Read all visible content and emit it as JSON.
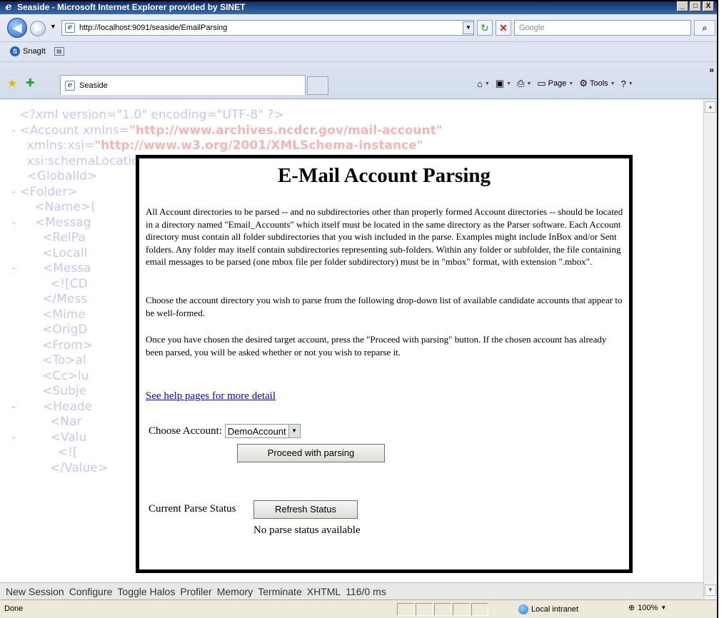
{
  "window": {
    "title": "Seaside - Microsoft Internet Explorer provided by SINET",
    "controls": [
      "_",
      "□",
      "X"
    ]
  },
  "toolbar": {
    "address": "http://localhost:9091/seaside/EmailParsing",
    "search_placeholder": "Google",
    "snagit_label": "SnagIt"
  },
  "tab": {
    "label": "Seaside"
  },
  "commandbar": {
    "page_label": "Page",
    "tools_label": "Tools"
  },
  "background_xml": [
    {
      "prefix": "  ",
      "text": "<?xml version=\"1.0\" encoding=\"UTF-8\" ?>",
      "value": ""
    },
    {
      "prefix": "- ",
      "text": "<Account xmlns=",
      "value": "\"http://www.archives.ncdcr.gov/mail-account\""
    },
    {
      "prefix": "  ",
      "text": "  xmlns:xsi=",
      "value": "\"http://www.w3.org/2001/XMLSchema-instance\""
    },
    {
      "prefix": "  ",
      "text": "  xsi:schemaLocation=\"http://www.archives.ncdcr.gov/mail-account mail-ac",
      "value": ""
    },
    {
      "prefix": "  ",
      "text": "  <GlobalId>                                                   g</Globa",
      "value": ""
    },
    {
      "prefix": "- ",
      "text": "<Folder>",
      "value": ""
    },
    {
      "prefix": "  ",
      "text": "    <Name>(",
      "value": ""
    },
    {
      "prefix": "- ",
      "text": "    <Messag",
      "value": ""
    },
    {
      "prefix": "  ",
      "text": "      <RelPa",
      "value": ""
    },
    {
      "prefix": "  ",
      "text": "      <LocalI",
      "value": ""
    },
    {
      "prefix": "- ",
      "text": "      <Messa",
      "value": ""
    },
    {
      "prefix": "  ",
      "text": "        <![CD",
      "value": ""
    },
    {
      "prefix": "  ",
      "text": "      </Mess",
      "value": ""
    },
    {
      "prefix": "  ",
      "text": "      <Mime",
      "value": ""
    },
    {
      "prefix": "  ",
      "text": "      <OrigD",
      "value": ""
    },
    {
      "prefix": "  ",
      "text": "      <From>",
      "value": ""
    },
    {
      "prefix": "  ",
      "text": "      <To>al",
      "value": ""
    },
    {
      "prefix": "  ",
      "text": "      <Cc>lu",
      "value": ""
    },
    {
      "prefix": "  ",
      "text": "      <Subje",
      "value": ""
    },
    {
      "prefix": "- ",
      "text": "      <Heade",
      "value": ""
    },
    {
      "prefix": "  ",
      "text": "        <Nar",
      "value": ""
    },
    {
      "prefix": "- ",
      "text": "        <Valu",
      "value": ""
    },
    {
      "prefix": "  ",
      "text": "          <![",
      "value": ""
    },
    {
      "prefix": "  ",
      "text": "        </Value>",
      "value": ""
    }
  ],
  "dialog": {
    "title": "E-Mail Account Parsing",
    "para1": "All Account directories to be parsed -- and no subdirectories other than properly formed Account directories -- should be located in a directory named \"Email_Accounts\" which itself must be located in the same directory as the Parser software. Each Account directory must contain all folder subdirectories that you wish included in the parse. Examples might include InBox and/or Sent folders. Any folder may itself contain subdirectories representing sub-folders. Within any folder or subfolder, the file containing email messages to be parsed (one mbox file per folder subdirectory) must be in \"mbox\" format, with extension \".mbox\".",
    "para2": "Choose the account directory you wish to parse from the following drop-down list of available candidate accounts that appear to be well-formed.",
    "para3": "Once you have chosen the desired target account, press the \"Proceed with parsing\" button. If the chosen account has already been parsed, you will be asked whether or not you wish to reparse it.",
    "help_link": "See help pages for more detail",
    "choose_label": "Choose Account:",
    "account_selected": "DemoAccount",
    "proceed_button": "Proceed with parsing",
    "status_label": "Current Parse Status",
    "refresh_button": "Refresh Status",
    "status_message": "No parse status available"
  },
  "footer_links": [
    "New Session",
    "Configure",
    "Toggle Halos",
    "Profiler",
    "Memory",
    "Terminate",
    "XHTML",
    "116/0 ms"
  ],
  "statusbar": {
    "text": "Done",
    "zone": "Local intranet",
    "zoom": "100%"
  },
  "colors": {
    "link": "#0000ee",
    "title_bar": "#0a246a",
    "xml_tag": "#c7c7ee",
    "xml_value": "#f5b5b5"
  }
}
